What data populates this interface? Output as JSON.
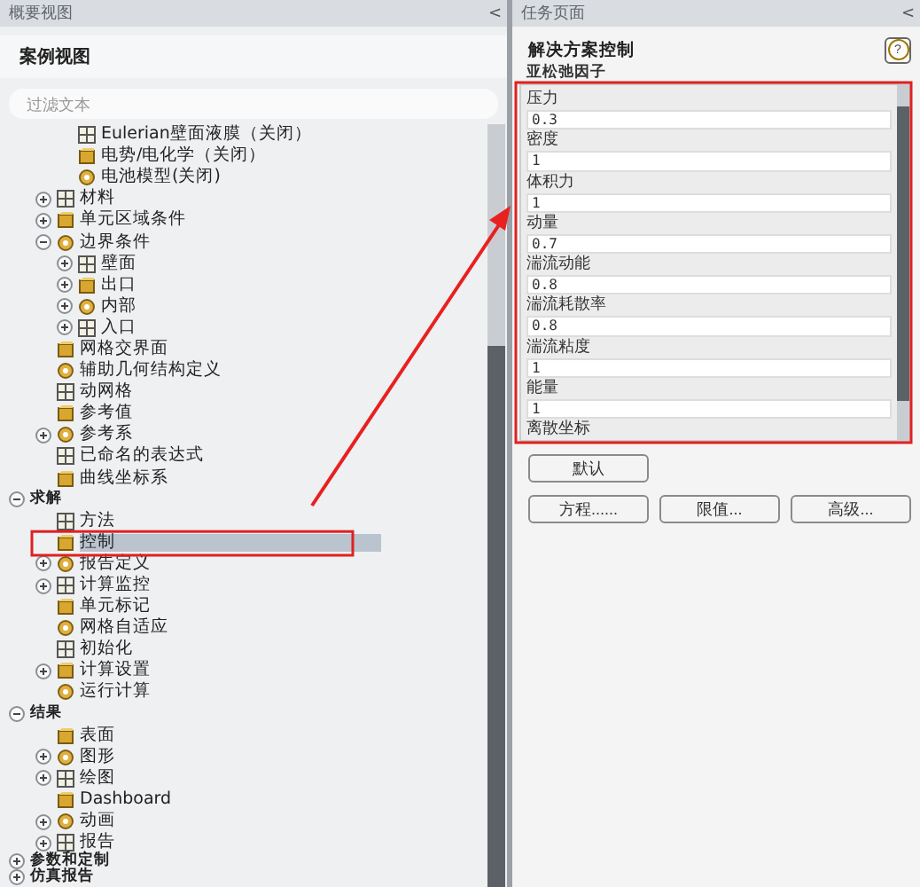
{
  "outline_panel": {
    "title": "概要视图",
    "collapse": "<",
    "section_title": "案例视图",
    "filter": {
      "placeholder": "过滤文本"
    },
    "tree": [
      {
        "children": [
          {
            "children": [
              {
                "label": "Eulerian壁面液膜（关闭）",
                "selected": false
              },
              {
                "label": "电势/电化学（关闭）",
                "selected": false
              },
              {
                "label": "电池模型(关闭)",
                "selected": false
              }
            ]
          },
          {
            "label": "材料",
            "expanded": false,
            "selected": false
          },
          {
            "label": "单元区域条件",
            "expanded": false,
            "selected": false
          },
          {
            "label": "边界条件",
            "expanded": true,
            "selected": false,
            "children": [
              {
                "label": "壁面",
                "expanded": false,
                "selected": false
              },
              {
                "label": "出口",
                "expanded": false,
                "selected": false
              },
              {
                "label": "内部",
                "expanded": false,
                "selected": false
              },
              {
                "label": "入口",
                "expanded": false,
                "selected": false
              }
            ]
          },
          {
            "label": "网格交界面",
            "selected": false
          },
          {
            "label": "辅助几何结构定义",
            "selected": false
          },
          {
            "label": "动网格",
            "selected": false
          },
          {
            "label": "参考值",
            "selected": false
          },
          {
            "label": "参考系",
            "expanded": false,
            "selected": false
          },
          {
            "label": "已命名的表达式",
            "selected": false
          },
          {
            "label": "曲线坐标系",
            "selected": false
          }
        ]
      },
      {
        "label": "求解",
        "expanded": true,
        "selected": false,
        "children": [
          {
            "label": "方法",
            "selected": false
          },
          {
            "label": "控制",
            "selected": true
          },
          {
            "label": "报告定义",
            "expanded": false,
            "selected": false
          },
          {
            "label": "计算监控",
            "expanded": false,
            "selected": false
          },
          {
            "label": "单元标记",
            "selected": false
          },
          {
            "label": "网格自适应",
            "selected": false
          },
          {
            "label": "初始化",
            "selected": false
          },
          {
            "label": "计算设置",
            "expanded": false,
            "selected": false
          },
          {
            "label": "运行计算",
            "selected": false
          }
        ]
      },
      {
        "label": "结果",
        "expanded": true,
        "selected": false,
        "children": [
          {
            "label": "表面",
            "selected": false
          },
          {
            "label": "图形",
            "expanded": false,
            "selected": false
          },
          {
            "label": "绘图",
            "expanded": false,
            "selected": false
          },
          {
            "label": "Dashboard",
            "selected": false
          },
          {
            "label": "动画",
            "expanded": false,
            "selected": false
          },
          {
            "label": "报告",
            "expanded": false,
            "selected": false
          }
        ]
      },
      {
        "label": "参数和定制",
        "expanded": false,
        "selected": false
      },
      {
        "label": "仿真报告",
        "expanded": false,
        "selected": false
      }
    ]
  },
  "task_panel": {
    "title": "任务页面",
    "collapse": "<",
    "heading": "解决方案控制",
    "help": "?",
    "group_title": "亚松弛因子",
    "fields": [
      {
        "label": "压力",
        "value": "0.3"
      },
      {
        "label": "密度",
        "value": "1"
      },
      {
        "label": "体积力",
        "value": "1"
      },
      {
        "label": "动量",
        "value": "0.7"
      },
      {
        "label": "湍流动能",
        "value": "0.8"
      },
      {
        "label": "湍流耗散率",
        "value": "0.8"
      },
      {
        "label": "湍流粘度",
        "value": "1"
      },
      {
        "label": "能量",
        "value": "1"
      },
      {
        "label": "离散坐标"
      }
    ],
    "buttons": [
      [
        "默认"
      ],
      [
        "方程......",
        "限值...",
        "高级..."
      ]
    ]
  }
}
